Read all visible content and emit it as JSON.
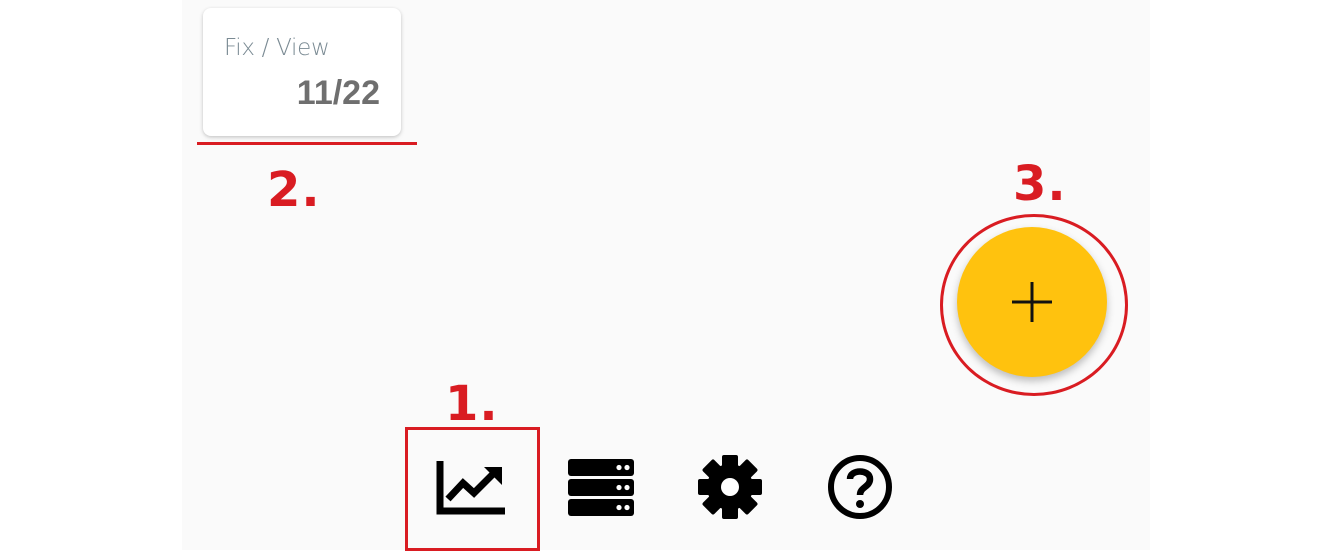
{
  "stat_card": {
    "label": "Fix / View",
    "value": "11/22"
  },
  "annotations": {
    "one": "1.",
    "two": "2.",
    "three": "3."
  },
  "fab": {
    "icon": "plus-icon",
    "color": "#ffc20e"
  },
  "bottom_nav": [
    {
      "icon": "chart-trend-icon"
    },
    {
      "icon": "server-icon"
    },
    {
      "icon": "gear-icon"
    },
    {
      "icon": "help-circle-icon"
    }
  ],
  "colors": {
    "annotation": "#d91c22",
    "background": "#fafafa",
    "icon": "#000000"
  }
}
